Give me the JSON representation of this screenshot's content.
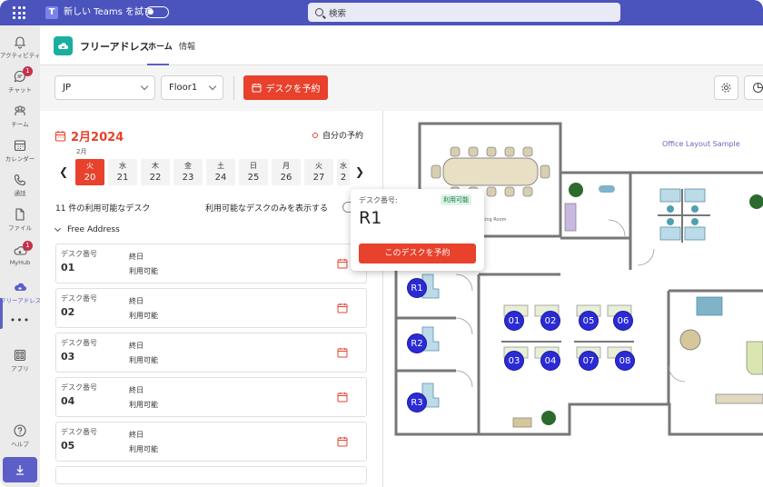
{
  "topbar": {
    "new_teams_label": "新しい Teams を試す",
    "search_placeholder": "検索"
  },
  "rail": {
    "items": [
      {
        "label": "アクティビティ",
        "icon": "bell-icon"
      },
      {
        "label": "チャット",
        "icon": "chat-icon",
        "badge": "1"
      },
      {
        "label": "チーム",
        "icon": "teams-icon"
      },
      {
        "label": "カレンダー",
        "icon": "calendar-icon"
      },
      {
        "label": "通話",
        "icon": "phone-icon"
      },
      {
        "label": "ファイル",
        "icon": "file-icon"
      },
      {
        "label": "MyHub",
        "icon": "myhub-icon",
        "badge": "1"
      },
      {
        "label": "フリーアドレス",
        "icon": "free-address-icon"
      },
      {
        "label": "アプリ",
        "icon": "apps-icon"
      },
      {
        "label": "ヘルプ",
        "icon": "help-icon"
      }
    ],
    "more": "•••"
  },
  "app": {
    "name": "フリーアドレス",
    "tabs": [
      {
        "label": "ホーム"
      },
      {
        "label": "情報"
      }
    ]
  },
  "toolbar": {
    "region": "JP",
    "floor": "Floor1",
    "reserve_label": "デスクを予約"
  },
  "calendar": {
    "month": "2月2024",
    "month_small": "2月",
    "mine_label": "自分の予約",
    "days": [
      {
        "w": "火",
        "d": "20",
        "selected": true
      },
      {
        "w": "水",
        "d": "21"
      },
      {
        "w": "木",
        "d": "22"
      },
      {
        "w": "金",
        "d": "23"
      },
      {
        "w": "土",
        "d": "24"
      },
      {
        "w": "日",
        "d": "25"
      },
      {
        "w": "月",
        "d": "26"
      },
      {
        "w": "火",
        "d": "27"
      },
      {
        "w": "水",
        "d": "2"
      }
    ]
  },
  "desk_list": {
    "count_label": "11 件の利用可能なデスク",
    "only_available_label": "利用可能なデスクのみを表示する",
    "group_label": "Free Address",
    "rows": [
      {
        "key": "デスク番号",
        "num": "01",
        "duration": "終日",
        "status": "利用可能"
      },
      {
        "key": "デスク番号",
        "num": "02",
        "duration": "終日",
        "status": "利用可能"
      },
      {
        "key": "デスク番号",
        "num": "03",
        "duration": "終日",
        "status": "利用可能"
      },
      {
        "key": "デスク番号",
        "num": "04",
        "duration": "終日",
        "status": "利用可能"
      },
      {
        "key": "デスク番号",
        "num": "05",
        "duration": "終日",
        "status": "利用可能"
      }
    ]
  },
  "map": {
    "title": "Office Layout Sample",
    "room_label": "ting Room",
    "desks": [
      "R1",
      "R2",
      "R3",
      "01",
      "02",
      "05",
      "06",
      "03",
      "04",
      "07",
      "08"
    ]
  },
  "popup": {
    "key_label": "デスク番号:",
    "status": "利用可能",
    "desk": "R1",
    "button": "このデスクを予約"
  },
  "colors": {
    "teams_purple": "#4b53bc",
    "accent_red": "#e8412c",
    "desk_blue": "#2b2bd6"
  }
}
